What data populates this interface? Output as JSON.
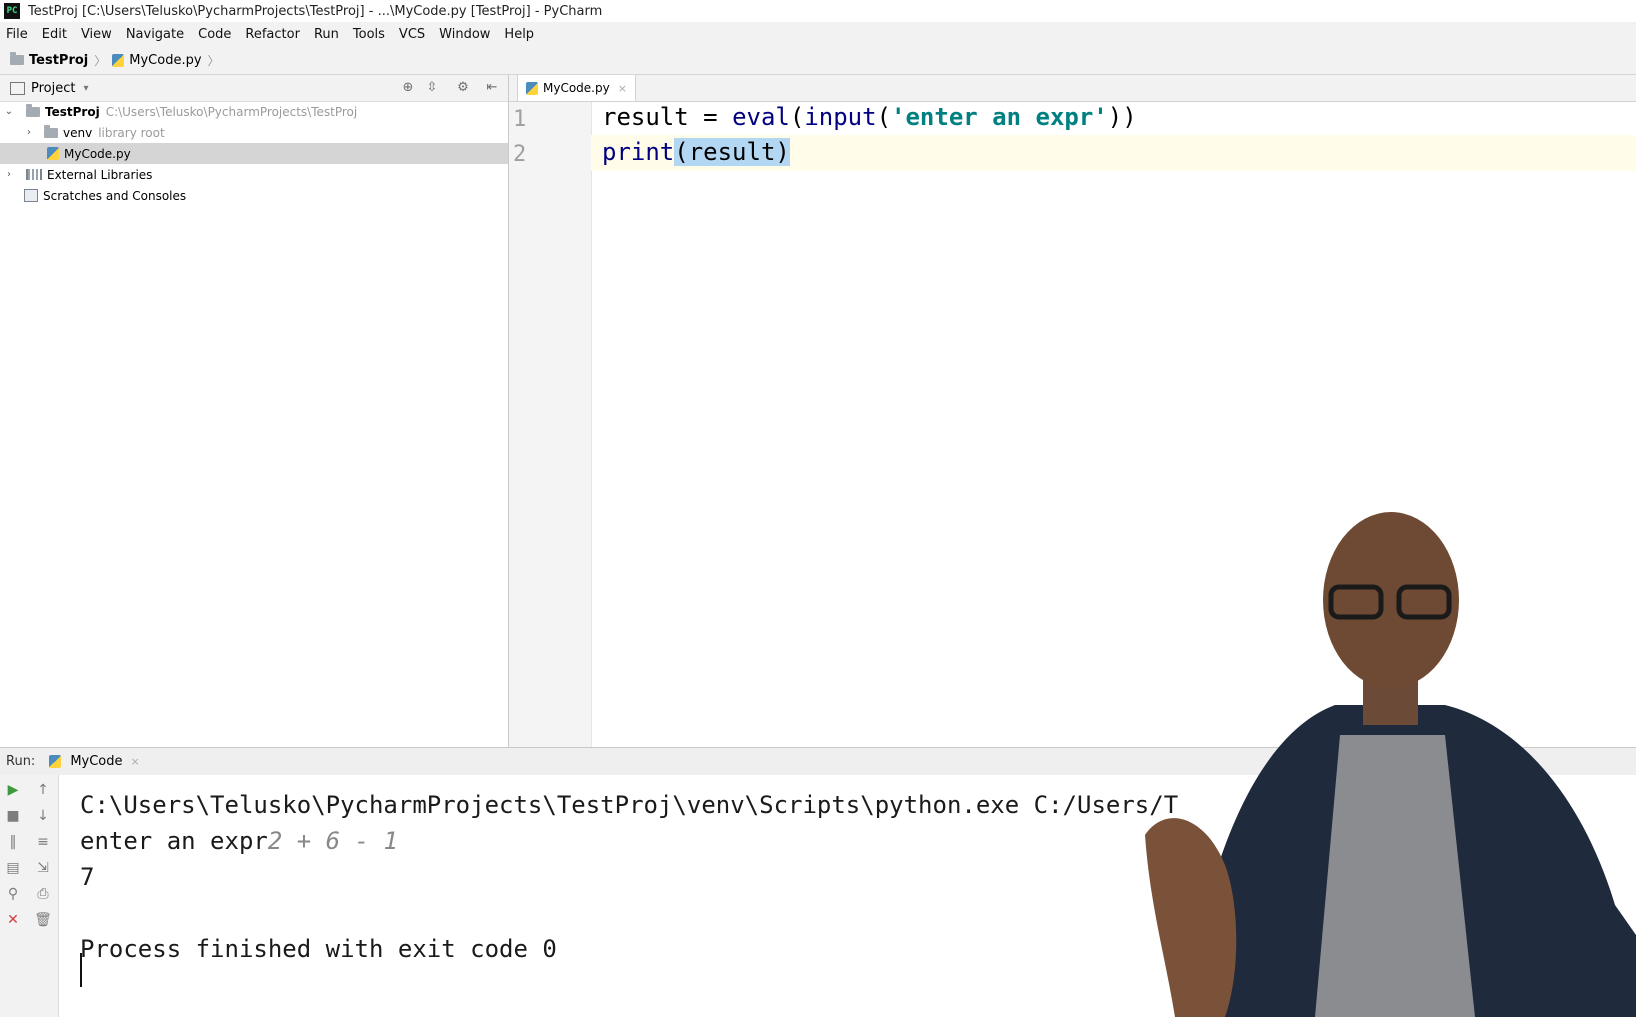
{
  "window": {
    "title": "TestProj [C:\\Users\\Telusko\\PycharmProjects\\TestProj] - ...\\MyCode.py [TestProj] - PyCharm",
    "app_icon": "PC"
  },
  "menubar": {
    "items": [
      "File",
      "Edit",
      "View",
      "Navigate",
      "Code",
      "Refactor",
      "Run",
      "Tools",
      "VCS",
      "Window",
      "Help"
    ]
  },
  "navbar": {
    "crumbs": [
      "TestProj",
      "MyCode.py"
    ]
  },
  "project_panel": {
    "title": "Project",
    "dropdown_icon": "▾",
    "tree": [
      {
        "label": "TestProj",
        "hint": "C:\\Users\\Telusko\\PycharmProjects\\TestProj",
        "expanded": true
      },
      {
        "label": "venv",
        "hint": "library root",
        "expanded": false
      },
      {
        "label": "MyCode.py",
        "selected": true
      },
      {
        "label": "External Libraries",
        "expanded": false
      },
      {
        "label": "Scratches and Consoles"
      }
    ]
  },
  "editor": {
    "tab_label": "MyCode.py",
    "tab_close": "×",
    "line_numbers": [
      "1",
      "2"
    ],
    "lines": [
      {
        "var": "result",
        "op": " = ",
        "fn1": "eval",
        "p1": "(",
        "fn2": "input",
        "p2": "(",
        "str": "'enter an expr'",
        "end": "))"
      },
      {
        "fn": "print",
        "arg_open": "(",
        "arg": "result",
        "arg_close": ")"
      }
    ]
  },
  "run_panel": {
    "label": "Run:",
    "config_name": "MyCode",
    "output": {
      "cmd": "C:\\Users\\Telusko\\PycharmProjects\\TestProj\\venv\\Scripts\\python.exe C:/Users/T",
      "prompt": "enter an expr",
      "user_input": "2 + 6 - 1",
      "result": "7",
      "finished": "Process finished with exit code 0"
    }
  },
  "colors": {
    "builtin": "#000080",
    "string": "#008080",
    "selection": "#b3d7f3",
    "run_green": "#3c9a3c",
    "stop_red": "#d04040"
  }
}
